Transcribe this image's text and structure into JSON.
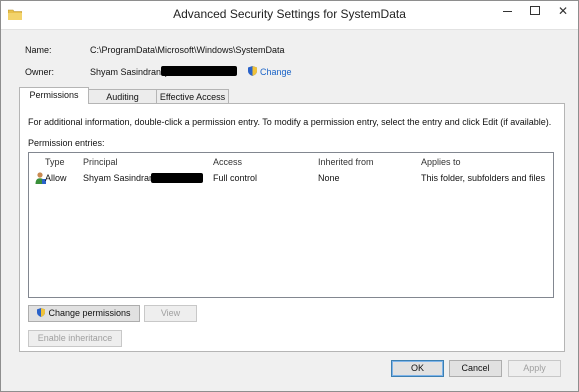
{
  "window": {
    "title": "Advanced Security Settings for SystemData",
    "minimize_label": "—",
    "close_label": "✕"
  },
  "header": {
    "name_label": "Name:",
    "name_value": "C:\\ProgramData\\Microsoft\\Windows\\SystemData",
    "owner_label": "Owner:",
    "owner_value": "Shyam Sasindran (",
    "change_link": "Change"
  },
  "tabs": [
    {
      "label": "Permissions",
      "active": true
    },
    {
      "label": "Auditing",
      "active": false
    },
    {
      "label": "Effective Access",
      "active": false
    }
  ],
  "permissions": {
    "info_text": "For additional information, double-click a permission entry. To modify a permission entry, select the entry and click Edit (if available).",
    "entries_label": "Permission entries:",
    "columns": [
      "Type",
      "Principal",
      "Access",
      "Inherited from",
      "Applies to"
    ],
    "rows": [
      {
        "type": "Allow",
        "principal": "Shyam Sasindran (",
        "access": "Full control",
        "inherited_from": "None",
        "applies_to": "This folder, subfolders and files"
      }
    ],
    "change_permissions_label": "Change permissions",
    "view_label": "View",
    "enable_inheritance_label": "Enable inheritance"
  },
  "footer": {
    "ok_label": "OK",
    "cancel_label": "Cancel",
    "apply_label": "Apply"
  },
  "colors": {
    "link": "#1b64c7",
    "shield_blue": "#2a62c9",
    "folder_yellow": "#e8c04a"
  },
  "icons": [
    "folder-icon",
    "shield-icon",
    "user-icon"
  ]
}
